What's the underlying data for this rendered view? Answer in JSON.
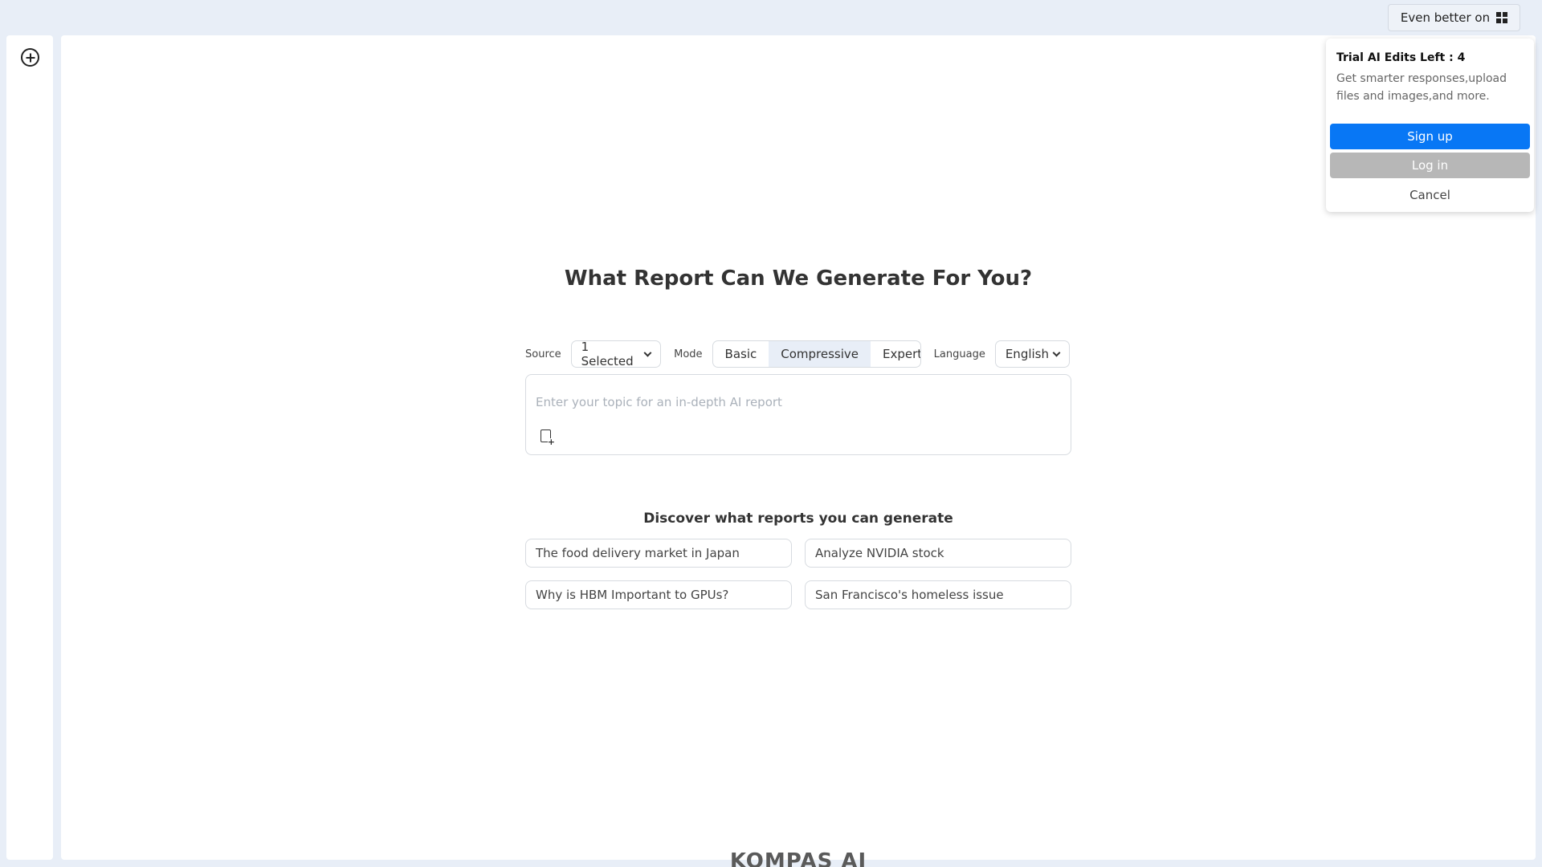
{
  "topbar": {
    "promo_label": "Even better on"
  },
  "icons": {
    "new_chat": "plus-circle-icon",
    "windows": "windows-icon",
    "attach": "file-plus-icon"
  },
  "main": {
    "heading": "What Report Can We Generate For You?",
    "controls": {
      "source_label": "Source",
      "source_value": "1 Selected",
      "mode_label": "Mode",
      "modes": [
        "Basic",
        "Compressive",
        "Expert"
      ],
      "active_mode": "Compressive",
      "language_label": "Language",
      "language_value": "English"
    },
    "topic_input": {
      "placeholder": "Enter your topic for an in-depth AI report",
      "value": ""
    },
    "discover": {
      "title": "Discover what reports you can generate",
      "suggestions": [
        "The food delivery market in Japan",
        "Analyze NVIDIA stock",
        "Why is HBM Important to GPUs?",
        "San Francisco's homeless issue"
      ]
    },
    "logo_text": "KOMPAS AI"
  },
  "popup": {
    "title": "Trial AI Edits Left : 4",
    "description": "Get smarter responses,upload files and images,and more.",
    "signup_label": "Sign up",
    "login_label": "Log in",
    "cancel_label": "Cancel"
  },
  "colors": {
    "background": "#e8eef7",
    "primary": "#0877f5",
    "login_button": "#b7b7b7",
    "logo": "#5a5a5a",
    "logo_accent": "#f07a3a"
  }
}
